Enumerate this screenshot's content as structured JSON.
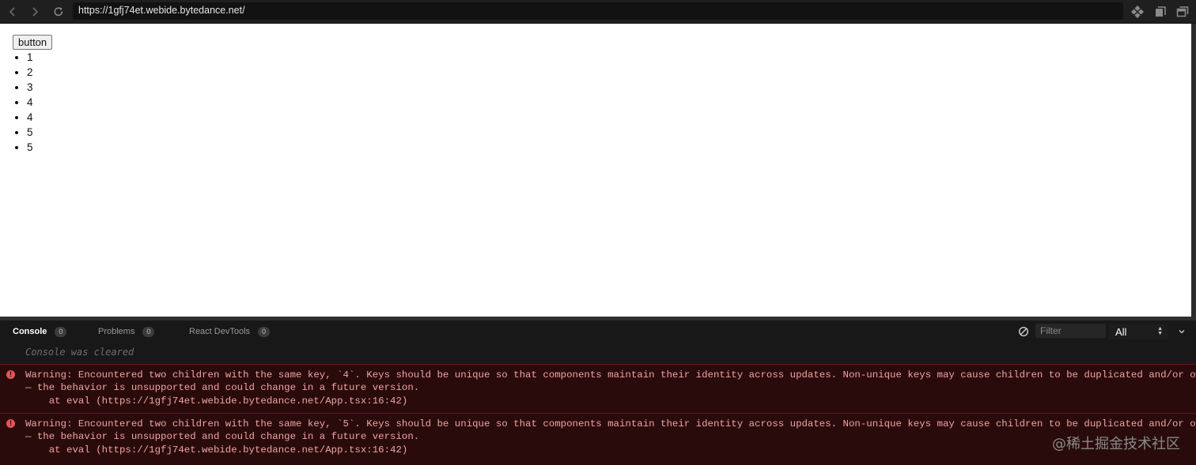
{
  "browser": {
    "url": "https://1gfj74et.webide.bytedance.net/"
  },
  "page": {
    "button_label": "button",
    "items": [
      "1",
      "2",
      "3",
      "4",
      "4",
      "5",
      "5"
    ]
  },
  "devtools": {
    "tabs": [
      {
        "label": "Console",
        "count": "0",
        "active": true
      },
      {
        "label": "Problems",
        "count": "0",
        "active": false
      },
      {
        "label": "React DevTools",
        "count": "0",
        "active": false
      }
    ],
    "filter_placeholder": "Filter",
    "level_selected": "All",
    "cleared_text": "Console was cleared",
    "messages": [
      {
        "level": "error",
        "line1": "Warning: Encountered two children with the same key, `4`. Keys should be unique so that components maintain their identity across updates. Non-unique keys may cause children to be duplicated and/or omitted",
        "line2": "— the behavior is unsupported and could change in a future version.",
        "line3": "    at eval (https://1gfj74et.webide.bytedance.net/App.tsx:16:42)"
      },
      {
        "level": "error",
        "line1": "Warning: Encountered two children with the same key, `5`. Keys should be unique so that components maintain their identity across updates. Non-unique keys may cause children to be duplicated and/or omitted",
        "line2": "— the behavior is unsupported and could change in a future version.",
        "line3": "    at eval (https://1gfj74et.webide.bytedance.net/App.tsx:16:42)"
      }
    ]
  },
  "watermark": "@稀土掘金技术社区",
  "colors": {
    "error_bg": "#2a0b0b",
    "error_text": "#f0a3a3",
    "error_icon": "#e0565b"
  }
}
